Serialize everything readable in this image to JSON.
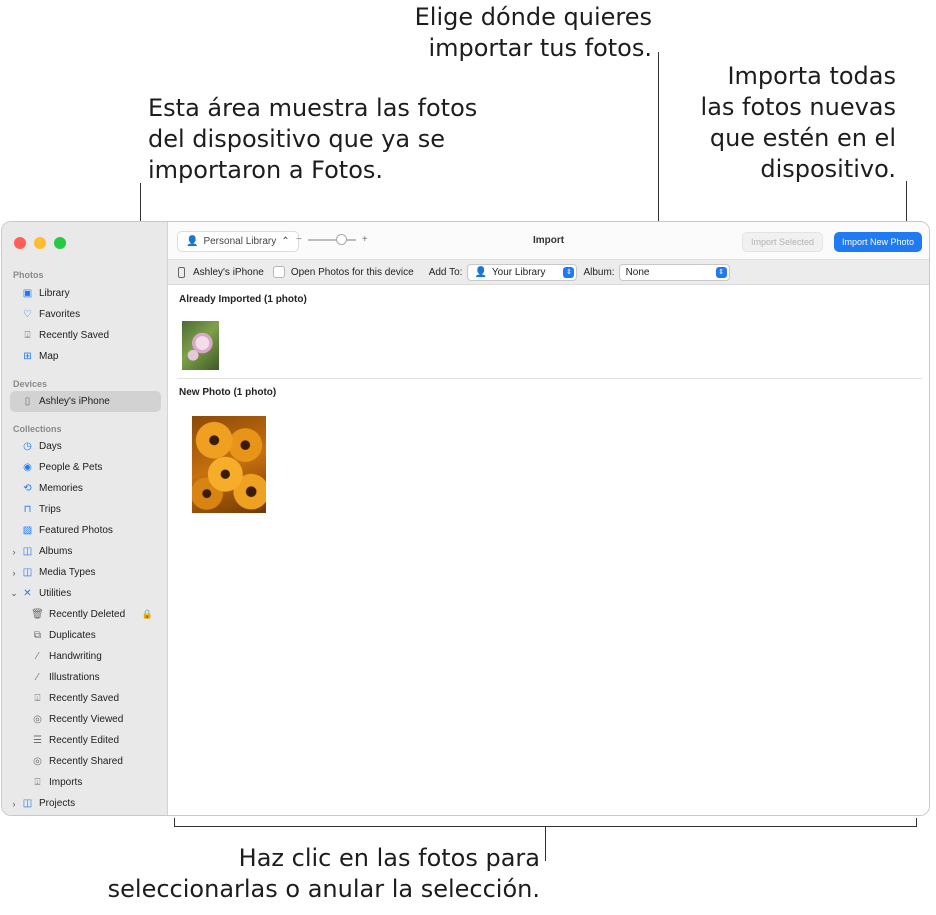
{
  "callouts": {
    "top_line1": "Elige dónde quieres",
    "top_line2": "importar tus fotos.",
    "left_line1": "Esta área muestra las fotos",
    "left_line2": "del dispositivo que ya se",
    "left_line3": "importaron a Fotos.",
    "right_line1": "Importa todas",
    "right_line2": "las fotos nuevas",
    "right_line3": "que estén en el",
    "right_line4": "dispositivo.",
    "bottom_line1": "Haz clic en las fotos para",
    "bottom_line2": "seleccionarlas o anular la selección."
  },
  "sidebar": {
    "photos_header": "Photos",
    "photos_items": [
      {
        "label": "Library",
        "icon": "library-icon"
      },
      {
        "label": "Favorites",
        "icon": "heart-icon"
      },
      {
        "label": "Recently Saved",
        "icon": "tray-icon"
      },
      {
        "label": "Map",
        "icon": "map-icon"
      }
    ],
    "devices_header": "Devices",
    "device_item": "Ashley's iPhone",
    "collections_header": "Collections",
    "collection_items": [
      {
        "label": "Days",
        "icon": "clock-icon"
      },
      {
        "label": "People & Pets",
        "icon": "person-circle-icon"
      },
      {
        "label": "Memories",
        "icon": "memories-icon"
      },
      {
        "label": "Trips",
        "icon": "suitcase-icon"
      },
      {
        "label": "Featured Photos",
        "icon": "photo-icon"
      },
      {
        "label": "Albums",
        "icon": "folder-icon"
      },
      {
        "label": "Media Types",
        "icon": "folder-icon"
      },
      {
        "label": "Utilities",
        "icon": "tools-icon"
      }
    ],
    "utility_items": [
      {
        "label": "Recently Deleted",
        "icon": "trash-icon"
      },
      {
        "label": "Duplicates",
        "icon": "duplicate-icon"
      },
      {
        "label": "Handwriting",
        "icon": "pen-icon"
      },
      {
        "label": "Illustrations",
        "icon": "illustration-icon"
      },
      {
        "label": "Recently Saved",
        "icon": "tray-icon"
      },
      {
        "label": "Recently Viewed",
        "icon": "eye-icon"
      },
      {
        "label": "Recently Edited",
        "icon": "edit-icon"
      },
      {
        "label": "Recently Shared",
        "icon": "share-icon"
      },
      {
        "label": "Imports",
        "icon": "import-icon"
      }
    ],
    "projects_item": "Projects"
  },
  "toolbar": {
    "library_select": "Personal Library",
    "zoom_minus": "−",
    "zoom_plus": "+",
    "title": "Import",
    "import_selected": "Import Selected",
    "import_new": "Import New Photo"
  },
  "device_bar": {
    "device_name": "Ashley's iPhone",
    "open_photos_label": "Open Photos for this device",
    "add_to_label": "Add To:",
    "add_to_value": "Your Library",
    "album_label": "Album:",
    "album_value": "None"
  },
  "content": {
    "already_imported": "Already Imported (1 photo)",
    "new_photo": "New Photo (1 photo)"
  },
  "colors": {
    "accent": "#1f7af3",
    "sidebar_bg": "#e9e9e9",
    "selected_bg": "#d2d2d2"
  }
}
